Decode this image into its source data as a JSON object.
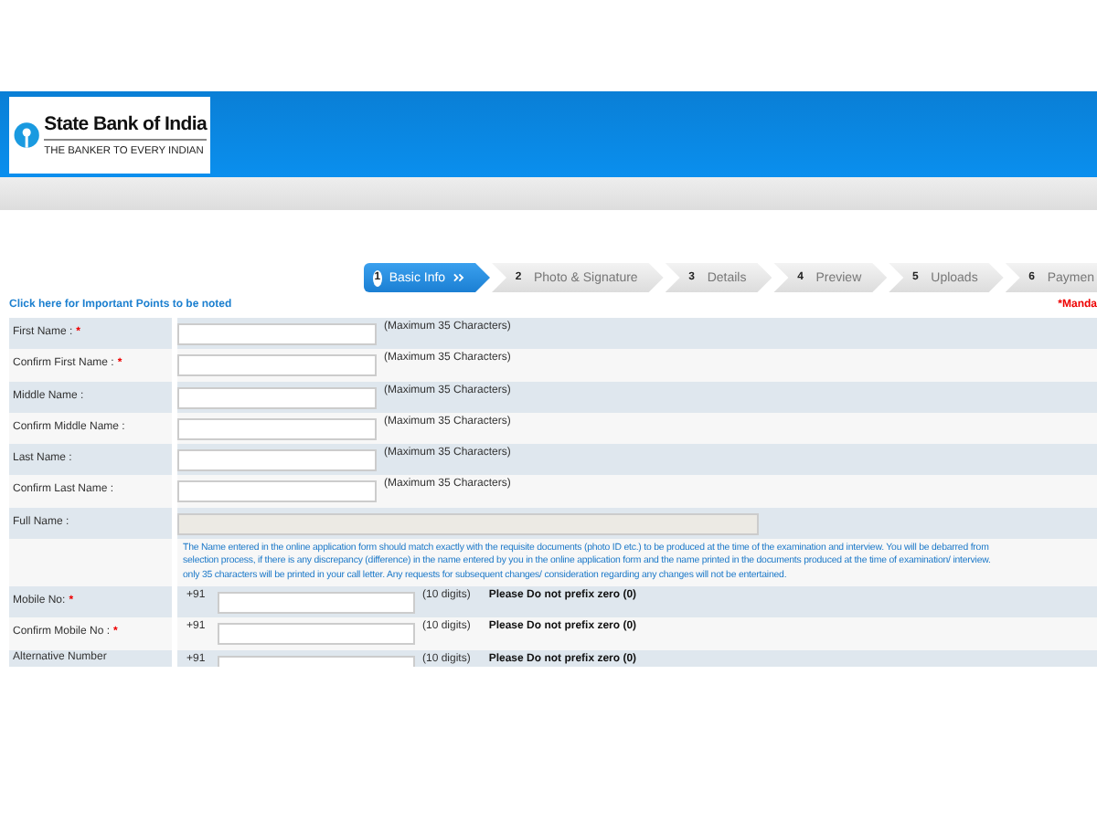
{
  "header": {
    "logo_title": "State Bank of India",
    "logo_tagline": "THE BANKER TO EVERY INDIAN"
  },
  "steps": [
    {
      "number": "1",
      "label": "Basic Info",
      "selected": true
    },
    {
      "number": "2",
      "label": "Photo & Signature",
      "selected": false
    },
    {
      "number": "3",
      "label": "Details",
      "selected": false
    },
    {
      "number": "4",
      "label": "Preview",
      "selected": false
    },
    {
      "number": "5",
      "label": "Uploads",
      "selected": false
    },
    {
      "number": "6",
      "label": "Paymen",
      "selected": false
    }
  ],
  "important_link": "Click here for Important Points to be noted",
  "mandatory_note": "*Manda",
  "rows": [
    {
      "kind": "text",
      "label": "First Name :",
      "required_mark": "*",
      "hint": "(Maximum 35 Characters)"
    },
    {
      "kind": "text",
      "label": "Confirm First Name :",
      "required_mark": "*",
      "hint": "(Maximum 35 Characters)"
    },
    {
      "kind": "text",
      "label": "Middle Name :",
      "hint": "(Maximum 35 Characters)"
    },
    {
      "kind": "text",
      "label": "Confirm Middle Name :",
      "hint": "(Maximum 35 Characters)"
    },
    {
      "kind": "text",
      "label": "Last Name :",
      "hint": "(Maximum 35 Characters)"
    },
    {
      "kind": "text",
      "label": "Confirm Last Name :",
      "hint": "(Maximum 35 Characters)"
    },
    {
      "kind": "readonly",
      "label": "Full Name :"
    },
    {
      "kind": "notice",
      "lines": [
        "The Name entered in the online application form should match exactly with the requisite documents (photo ID etc.) to be produced at the time of the examination and interview. You will be debarred from",
        "selection process, if there is any discrepancy (difference) in the name entered by you in the online application form and the name printed in the documents produced at the time of examination/ interview.",
        "only 35 characters will be printed in your call letter. Any requests for subsequent changes/ consideration regarding any changes will not be entertained."
      ]
    },
    {
      "kind": "mobile",
      "label": "Mobile No:",
      "required_mark": "*",
      "prefix": "+91",
      "hint": "(10 digits)",
      "note": "Please Do not prefix zero (0)"
    },
    {
      "kind": "mobile",
      "label": "Confirm Mobile No :",
      "required_mark": "*",
      "prefix": "+91",
      "hint": "(10 digits)",
      "note": "Please Do not prefix zero (0)"
    },
    {
      "kind": "mobile_partial",
      "label": "Alternative Number",
      "prefix": "+91",
      "hint": "(10 digits)",
      "note": "Please Do not prefix zero (0)"
    }
  ]
}
